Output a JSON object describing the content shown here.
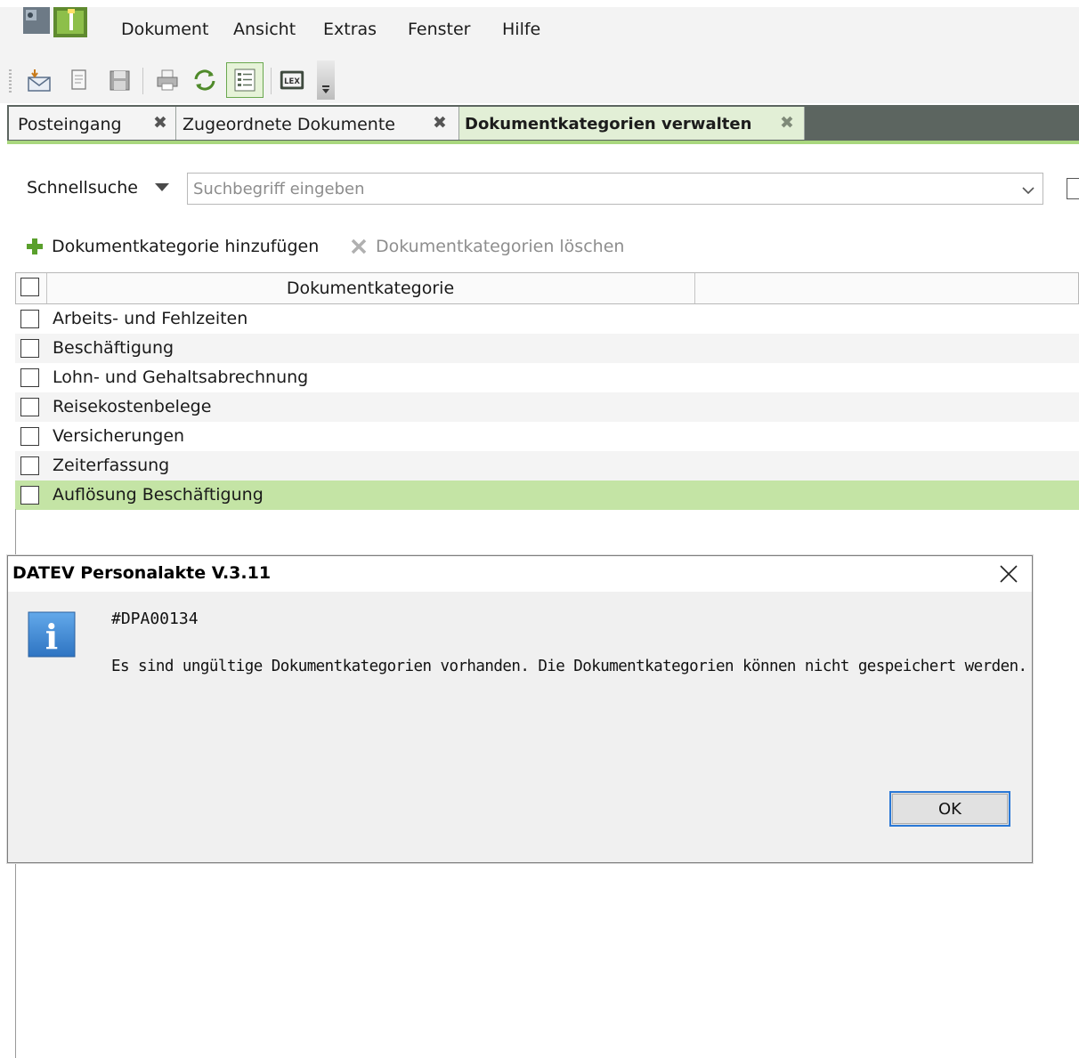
{
  "menu": [
    "Dokument",
    "Ansicht",
    "Extras",
    "Fenster",
    "Hilfe"
  ],
  "toolbar": {
    "icons": [
      "inbox-icon",
      "document-icon",
      "save-icon",
      "print-icon",
      "refresh-icon",
      "list-icon",
      "lex-icon",
      "overflow-icon"
    ],
    "lex_label": "LEX"
  },
  "tabs": [
    {
      "label": "Posteingang",
      "active": false
    },
    {
      "label": "Zugeordnete Dokumente",
      "active": false
    },
    {
      "label": "Dokumentkategorien verwalten",
      "active": true
    }
  ],
  "tab_close_glyph": "✖",
  "search": {
    "label": "Schnellsuche",
    "placeholder": "Suchbegriff eingeben",
    "value": ""
  },
  "actions": {
    "add_label": "Dokumentkategorie hinzufügen",
    "delete_label": "Dokumentkategorien löschen"
  },
  "grid": {
    "column_header": "Dokumentkategorie",
    "rows": [
      {
        "label": "Arbeits- und Fehlzeiten",
        "checked": false,
        "selected": false
      },
      {
        "label": "Beschäftigung",
        "checked": false,
        "selected": false
      },
      {
        "label": "Lohn- und Gehaltsabrechnung",
        "checked": false,
        "selected": false
      },
      {
        "label": "Reisekostenbelege",
        "checked": false,
        "selected": false
      },
      {
        "label": "Versicherungen",
        "checked": false,
        "selected": false
      },
      {
        "label": "Zeiterfassung",
        "checked": false,
        "selected": false
      },
      {
        "label": "Auflösung Beschäftigung",
        "checked": false,
        "selected": true
      }
    ]
  },
  "dialog": {
    "title": "DATEV Personalakte V.3.11",
    "code": "#DPA00134",
    "message": "Es sind ungültige Dokumentkategorien vorhanden. Die Dokumentkategorien können nicht gespeichert werden.",
    "ok_label": "OK",
    "icon": "info-icon",
    "icon_glyph": "i"
  },
  "colors": {
    "tab_bar": "#5c6560",
    "accent_green": "#a9d77e",
    "selected_row": "#c4e4a5",
    "info_blue": "#3a86d4",
    "ok_border": "#2a78d6"
  }
}
